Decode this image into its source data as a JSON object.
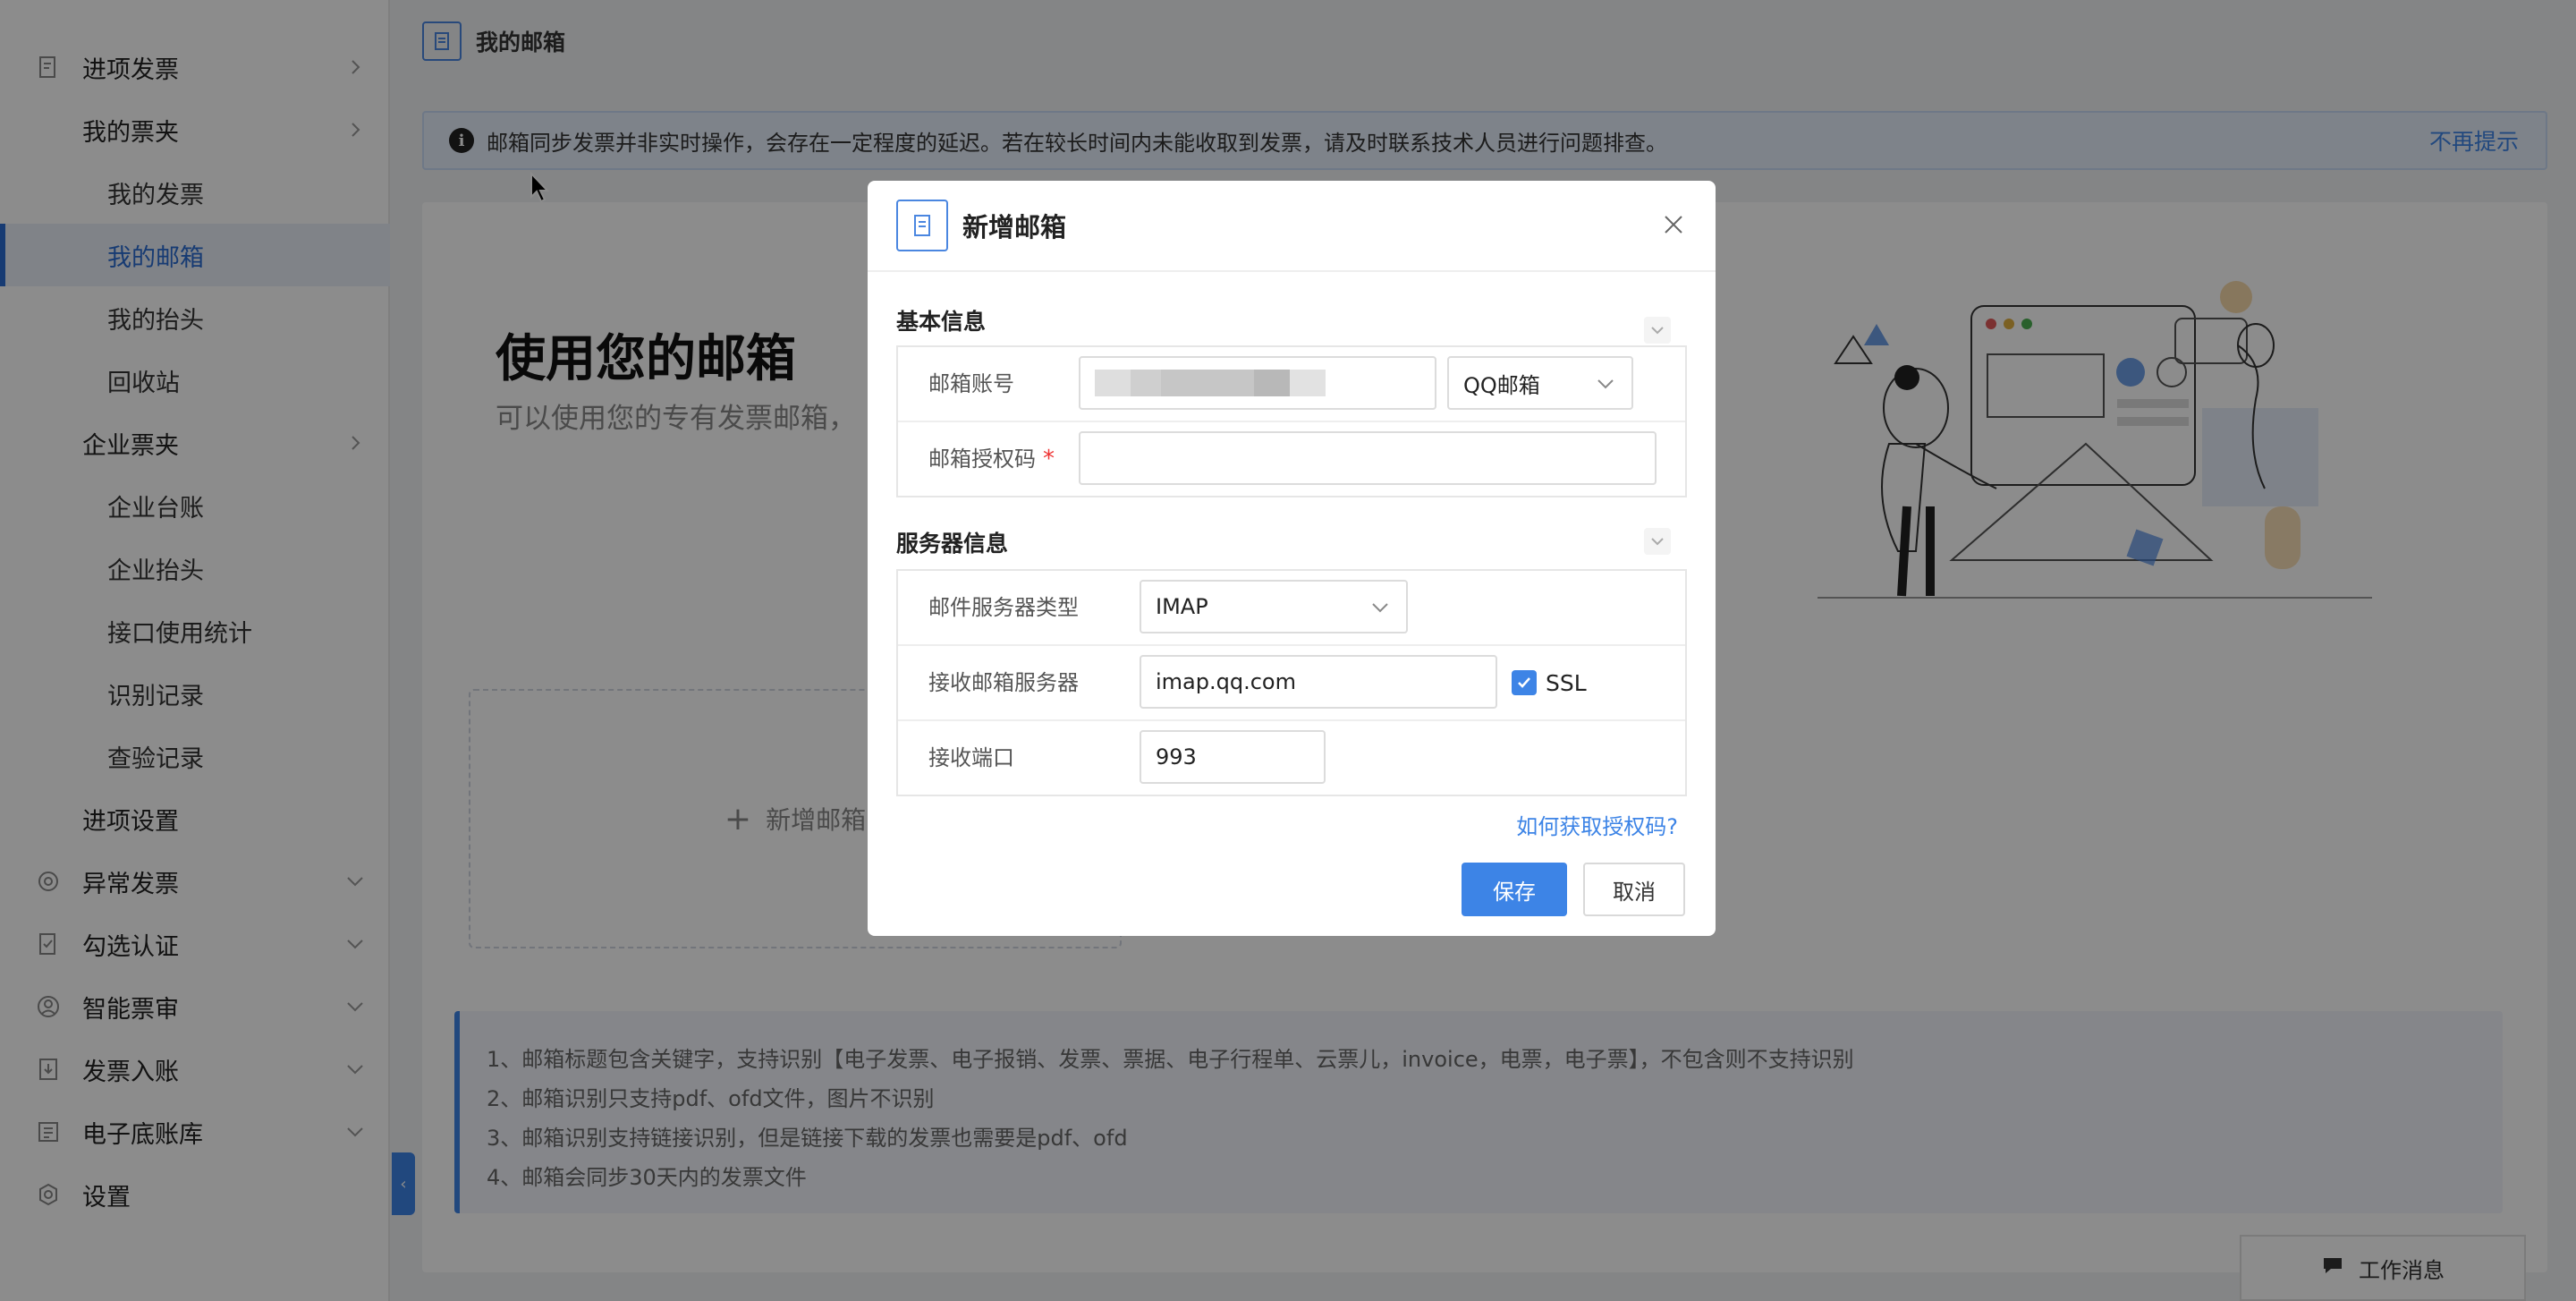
{
  "sidebar": {
    "items": [
      {
        "label": "进项发票",
        "icon": "invoice-icon"
      },
      {
        "label": "我的票夹"
      },
      {
        "label": "我的发票"
      },
      {
        "label": "我的邮箱",
        "active": true
      },
      {
        "label": "我的抬头"
      },
      {
        "label": "回收站"
      },
      {
        "label": "企业票夹"
      },
      {
        "label": "企业台账"
      },
      {
        "label": "企业抬头"
      },
      {
        "label": "接口使用统计"
      },
      {
        "label": "识别记录"
      },
      {
        "label": "查验记录"
      },
      {
        "label": "进项设置"
      },
      {
        "label": "异常发票",
        "icon": "at-icon"
      },
      {
        "label": "勾选认证",
        "icon": "checklist-icon"
      },
      {
        "label": "智能票审",
        "icon": "user-circle-icon"
      },
      {
        "label": "发票入账",
        "icon": "download-doc-icon"
      },
      {
        "label": "电子底账库",
        "icon": "ledger-icon"
      },
      {
        "label": "设置",
        "icon": "gear-icon"
      }
    ]
  },
  "header": {
    "title": "我的邮箱"
  },
  "notice": {
    "message": "邮箱同步发票并非实时操作，会存在一定程度的延迟。若在较长时间内未能收取到发票，请及时联系技术人员进行问题排查。",
    "dismiss": "不再提示"
  },
  "main": {
    "hero_title": "使用您的邮箱",
    "hero_subtitle": "可以使用您的专有发票邮箱，",
    "add_label": "新增邮箱",
    "tips": [
      "1、邮箱标题包含关键字，支持识别【电子发票、电子报销、发票、票据、电子行程单、云票儿，invoice，电票，电子票】，不包含则不支持识别",
      "2、邮箱识别只支持pdf、ofd文件，图片不识别",
      "3、邮箱识别支持链接识别，但是链接下载的发票也需要是pdf、ofd",
      "4、邮箱会同步30天内的发票文件"
    ]
  },
  "work_message": "工作消息",
  "dialog": {
    "title": "新增邮箱",
    "basic_section": "基本信息",
    "account_label": "邮箱账号",
    "mail_type": "QQ邮箱",
    "auth_label": "邮箱授权码",
    "auth_value": "",
    "server_section": "服务器信息",
    "server_type_label": "邮件服务器类型",
    "server_type": "IMAP",
    "receive_server_label": "接收邮箱服务器",
    "receive_server": "imap.qq.com",
    "ssl_label": "SSL",
    "ssl_checked": true,
    "port_label": "接收端口",
    "port": "993",
    "help_link": "如何获取授权码?",
    "save": "保存",
    "cancel": "取消"
  },
  "colors": {
    "accent": "#3d84e6",
    "required": "#e33333"
  }
}
